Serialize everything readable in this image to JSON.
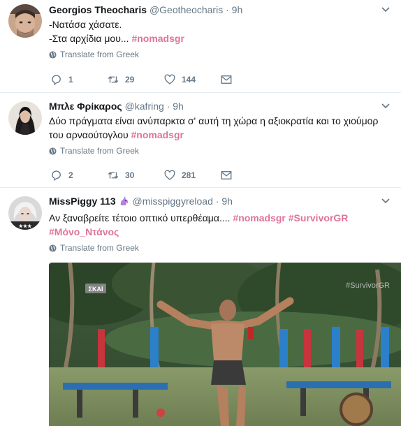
{
  "tweets": [
    {
      "name": "Georgios Theocharis",
      "handle": "@Geotheocharis",
      "time": "9h",
      "lines": [
        "-Νατάσα χάσατε.",
        "-Στα αρχίδια μου..."
      ],
      "hashtags": [
        "#nomadsgr"
      ],
      "translate_label": "Translate from Greek",
      "replies": "1",
      "retweets": "29",
      "likes": "144"
    },
    {
      "name": "Μπλε Φρίκαρος",
      "handle": "@kafring",
      "time": "9h",
      "text_line1": "Δύο πράγματα είναι ανύπαρκτα σ' αυτή τη χώρα η αξιοκρατία και το χιούμορ",
      "text_line2": "του αρναούτογλου",
      "hashtags": [
        "#nomadsgr"
      ],
      "translate_label": "Translate from Greek",
      "replies": "2",
      "retweets": "30",
      "likes": "281"
    },
    {
      "name": "MissPiggy 113",
      "name_emoji": "unicorn-icon",
      "handle": "@misspiggyreload",
      "time": "9h",
      "text_line1": "Αν ξαναβρείτε τέτοιο οπτικό υπερθέαμα....",
      "hashtags": [
        "#nomadsgr",
        "#SurvivorGR",
        "#Μόνο_Ντάνος"
      ],
      "translate_label": "Translate from Greek",
      "media": {
        "channel_logo": "ΣΚΑΪ",
        "watermark": "#SurvivorGR"
      }
    }
  ],
  "colors": {
    "hashtag": "#e0739b",
    "muted": "#657786",
    "divider": "#e6ecf0"
  }
}
